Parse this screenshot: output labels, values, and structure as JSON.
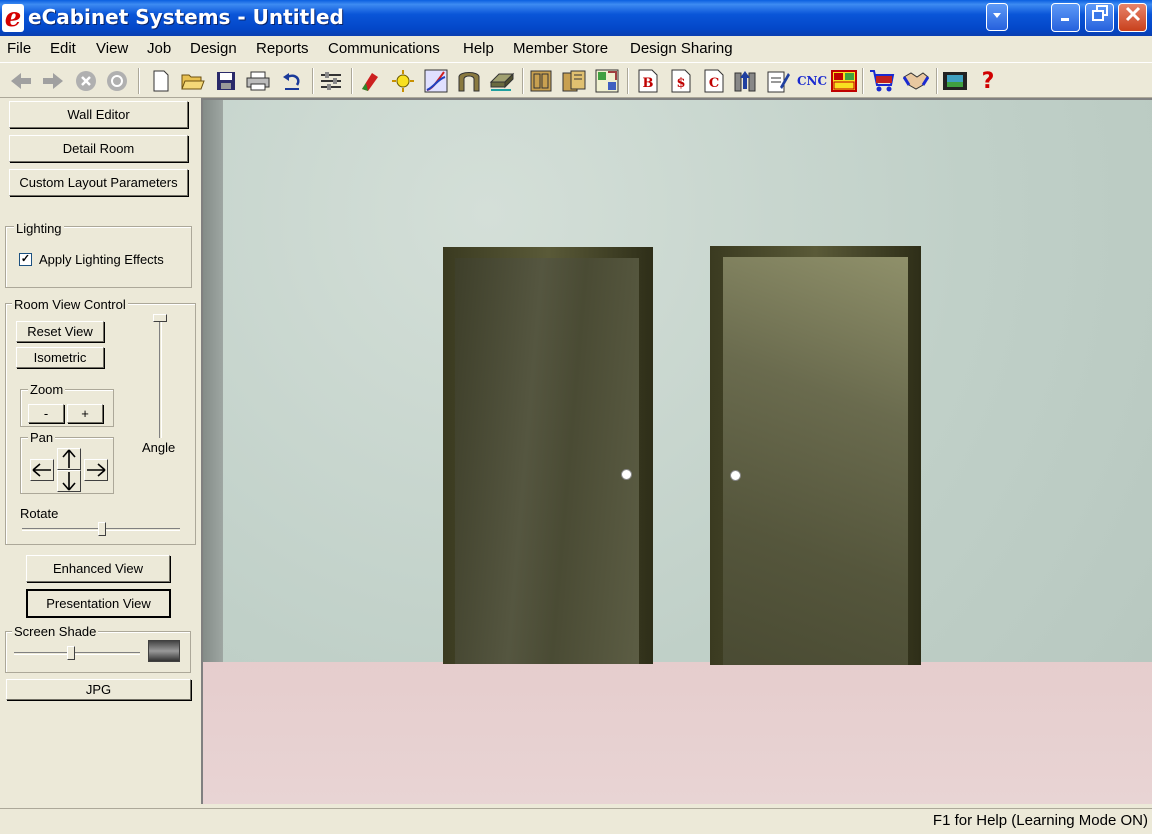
{
  "window": {
    "app_icon": "e",
    "title": "eCabinet Systems - Untitled",
    "minimize_icon": "minimize-icon",
    "maximize_icon": "restore-icon",
    "close_icon": "close-icon"
  },
  "menu": [
    "File",
    "Edit",
    "View",
    "Job",
    "Design",
    "Reports",
    "Communications",
    "Help",
    "Member Store",
    "Design Sharing"
  ],
  "toolbar": {
    "cnc_label": "CNC",
    "bid_label": "B",
    "cost_label": "$",
    "cutlist_label": "C",
    "help_label": "?"
  },
  "left_panel": {
    "wall_editor": "Wall Editor",
    "detail_room": "Detail Room",
    "custom_layout": "Custom Layout Parameters",
    "lighting": {
      "title": "Lighting",
      "apply_label": "Apply Lighting Effects",
      "checked": true,
      "check_mark": "✓"
    },
    "room_view": {
      "title": "Room View Control",
      "reset": "Reset View",
      "isometric": "Isometric",
      "zoom_title": "Zoom",
      "zoom_out": "-",
      "zoom_in": "+",
      "pan_title": "Pan",
      "angle_label": "Angle",
      "rotate_label": "Rotate"
    },
    "enhanced_view": "Enhanced View",
    "presentation_view": "Presentation View",
    "screen_shade": "Screen Shade",
    "jpg": "JPG"
  },
  "status": {
    "text": "F1 for Help (Learning Mode ON)"
  },
  "colors": {
    "title_bar": "#0a55d8",
    "wall": "#c0d0c8",
    "floor": "#e6cdcd",
    "door": "#55563a"
  }
}
